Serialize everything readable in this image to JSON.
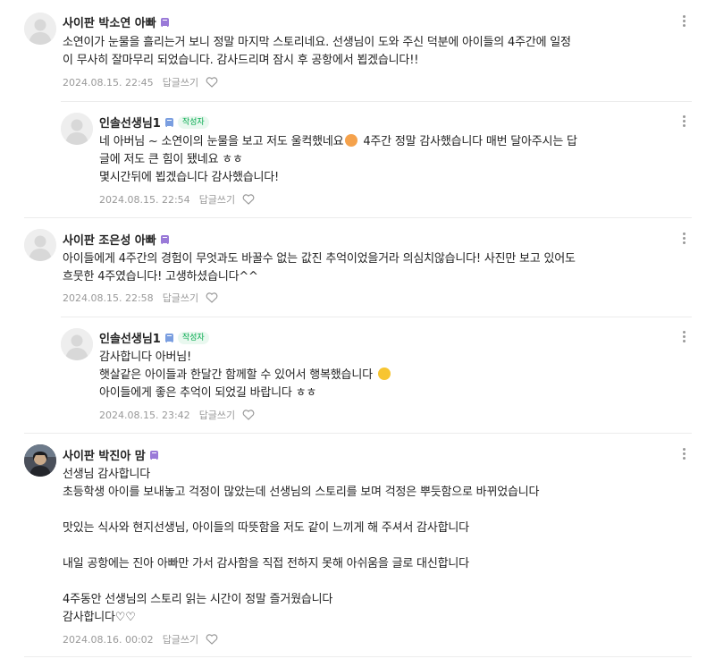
{
  "comments": [
    {
      "author": "사이판 박소연 아빠",
      "level": "purple",
      "is_writer": false,
      "lines": [
        "소연이가 눈물을 흘리는거 보니 정말 마지막 스토리네요. 선생님이 도와 주신 덕분에 아이들의 4주간에 일정",
        "이 무사히 잘마무리 되었습니다. 감사드리며 잠시 후 공항에서 뵙겠습니다!!"
      ],
      "date": "2024.08.15. 22:45",
      "reply_label": "답글쓰기"
    },
    {
      "author": "인솔선생님1",
      "level": "blue",
      "is_writer": true,
      "writer_label": "작성자",
      "lines_before_emoji": "네 아버님 ~ 소연이의 눈물을 보고 저도 울컥했네요",
      "lines_after_emoji": " 4주간 정말 감사했습니다 매번 달아주시는 답",
      "lines": [
        "글에 저도 큰 힘이 됐네요 ㅎㅎ",
        "몇시간뒤에 뵙겠습니다 감사했습니다!"
      ],
      "date": "2024.08.15. 22:54",
      "reply_label": "답글쓰기"
    },
    {
      "author": "사이판 조은성 아빠",
      "level": "purple",
      "is_writer": false,
      "lines": [
        "아이들에게 4주간의 경험이 무엇과도 바꿀수 없는 값진 추억이었을거라 의심치않습니다! 사진만 보고 있어도",
        "흐뭇한 4주였습니다! 고생하셨습니다^^"
      ],
      "date": "2024.08.15. 22:58",
      "reply_label": "답글쓰기"
    },
    {
      "author": "인솔선생님1",
      "level": "blue",
      "is_writer": true,
      "writer_label": "작성자",
      "line1": "감사합니다 아버님!",
      "line2": "햇살같은 아이들과 한달간 함께할 수 있어서 행복했습니다",
      "line3": "아이들에게 좋은 추억이 되었길 바랍니다 ㅎㅎ",
      "date": "2024.08.15. 23:42",
      "reply_label": "답글쓰기"
    },
    {
      "author": "사이판 박진아 맘",
      "level": "purple",
      "is_writer": false,
      "lines": [
        "선생님 감사합니다",
        "초등학생 아이를 보내놓고 걱정이 많았는데 선생님의 스토리를 보며 걱정은 뿌듯함으로 바뀌었습니다",
        "",
        "맛있는 식사와 현지선생님, 아이들의 따뜻함을 저도 같이 느끼게 해 주셔서 감사합니다",
        "",
        "내일 공항에는 진아 아빠만 가서 감사함을 직접 전하지 못해 아쉬움을 글로 대신합니다",
        "",
        "4주동안 선생님의 스토리 읽는 시간이 정말 즐거웠습니다",
        "감사합니다♡♡"
      ],
      "date": "2024.08.16. 00:02",
      "reply_label": "답글쓰기"
    }
  ],
  "icons": {
    "like": "heart-outline-icon",
    "more": "more-vertical-icon",
    "avatar_default": "default-avatar-icon"
  },
  "colors": {
    "writer_tag": "#03a94d",
    "level_purple": "#9a7ad8",
    "level_blue": "#7a9ee0",
    "meta": "#999999"
  }
}
